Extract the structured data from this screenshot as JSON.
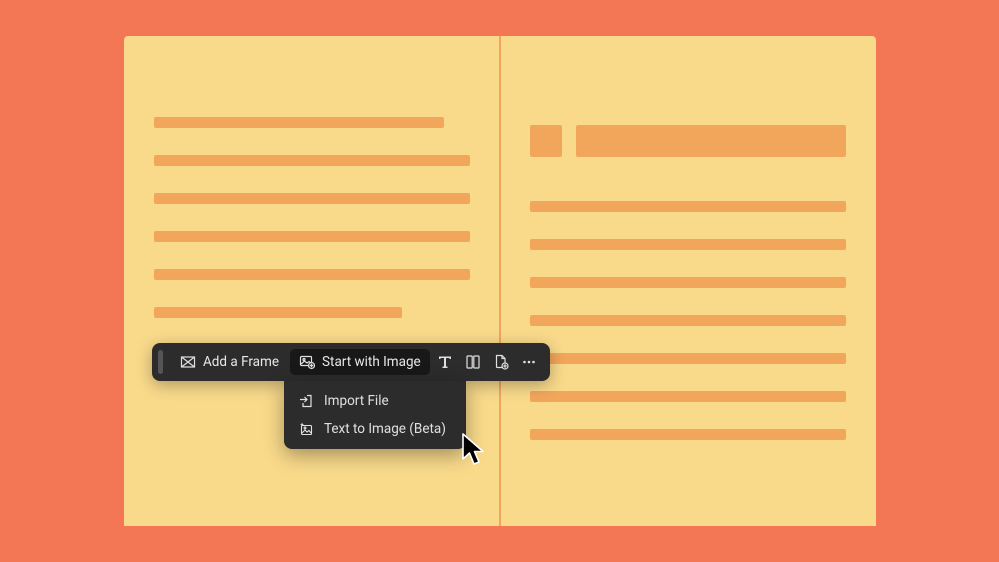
{
  "toolbar": {
    "add_frame_label": "Add a Frame",
    "start_image_label": "Start with Image"
  },
  "dropdown": {
    "import_file_label": "Import File",
    "text_to_image_label": "Text to Image (Beta)"
  }
}
